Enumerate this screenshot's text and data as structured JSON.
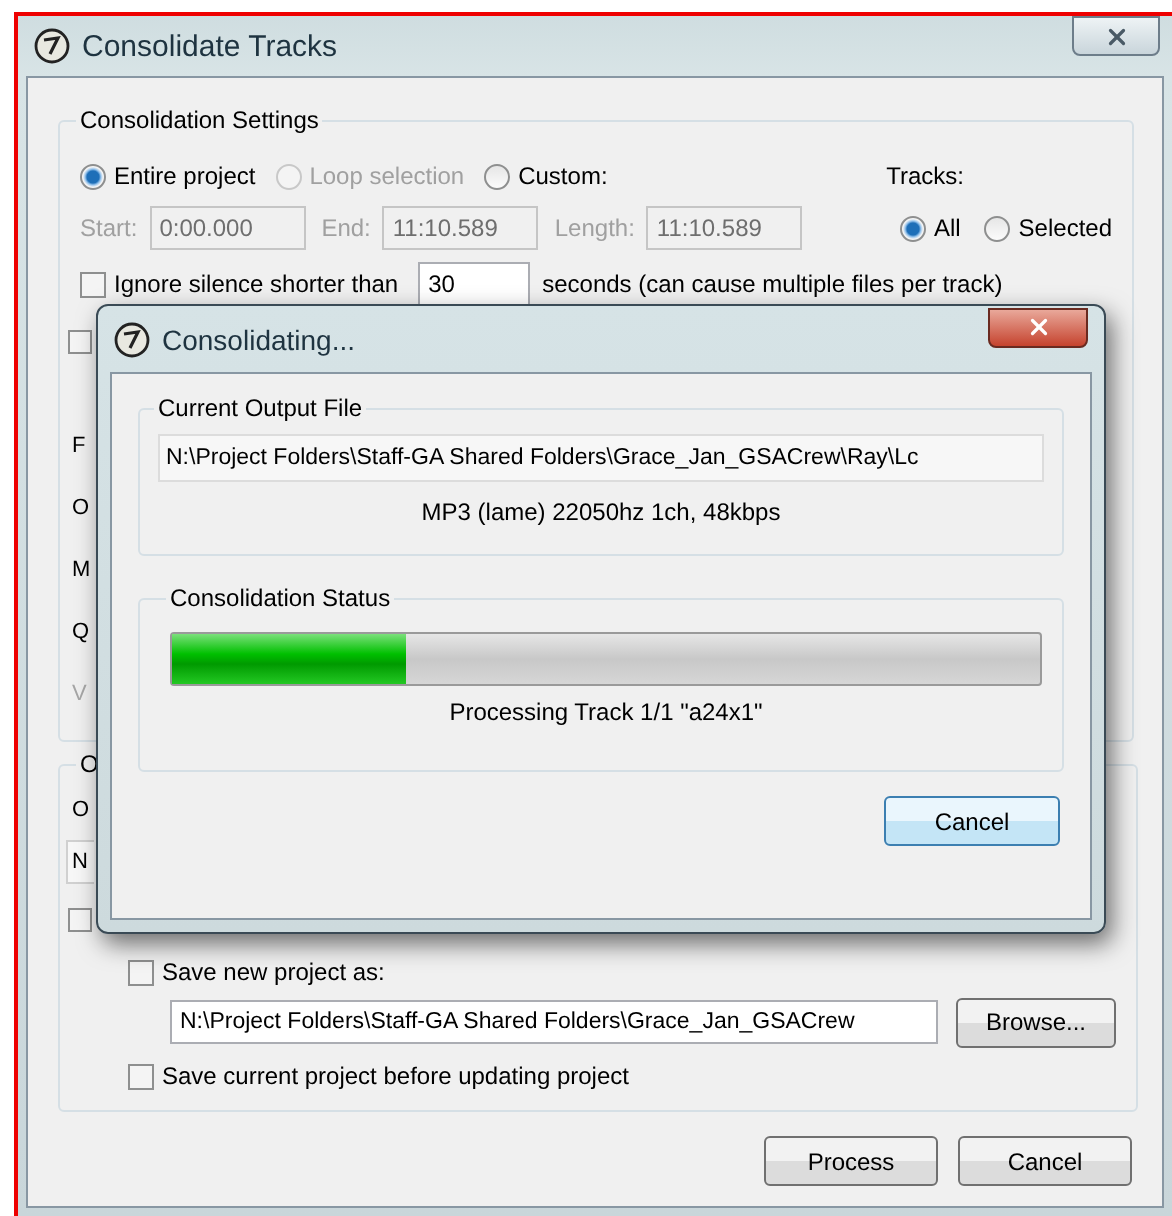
{
  "window": {
    "title": "Consolidate Tracks"
  },
  "settings": {
    "title": "Consolidation Settings",
    "range_options": [
      {
        "label": "Entire project",
        "selected": true,
        "disabled": false
      },
      {
        "label": "Loop selection",
        "selected": false,
        "disabled": true
      },
      {
        "label": "Custom:",
        "selected": false,
        "disabled": false
      }
    ],
    "tracks_label": "Tracks:",
    "times": [
      {
        "label": "Start:",
        "value": "0:00.000",
        "disabled": true
      },
      {
        "label": "End:",
        "value": "11:10.589",
        "disabled": true
      },
      {
        "label": "Length:",
        "value": "11:10.589",
        "disabled": true
      }
    ],
    "track_options": [
      {
        "label": "All",
        "selected": true
      },
      {
        "label": "Selected",
        "selected": false
      }
    ],
    "ignore_silence": {
      "checked": false,
      "label": "Ignore silence shorter than",
      "value": "30",
      "suffix": "seconds (can cause multiple files per track)"
    },
    "covered_option": {
      "checked": false
    },
    "covered_labels": [
      {
        "text": "F",
        "disabled": false
      },
      {
        "text": "O",
        "disabled": false
      },
      {
        "text": "M",
        "disabled": false
      },
      {
        "text": "Q",
        "disabled": false
      },
      {
        "text": "V",
        "disabled": true
      }
    ]
  },
  "output": {
    "title": "O",
    "label": "O",
    "field": "N",
    "covered_option": {
      "checked": false
    },
    "save_new": {
      "checked": false,
      "label": "Save new project as:",
      "path": "N:\\Project Folders\\Staff-GA Shared Folders\\Grace_Jan_GSACrew",
      "button": "Browse..."
    },
    "save_current": {
      "checked": false,
      "label": "Save current project before updating project"
    }
  },
  "buttons": [
    "Process",
    "Cancel"
  ],
  "progress_dialog": {
    "title": "Consolidating...",
    "output_title": "Current Output File",
    "output_path": "N:\\Project Folders\\Staff-GA Shared Folders\\Grace_Jan_GSACrew\\Ray\\Lc",
    "format": "MP3 (lame) 22050hz 1ch, 48kbps",
    "status_title": "Consolidation Status",
    "level": 0.27,
    "status": "Processing Track 1/1 \"a24x1\"",
    "cancel": "Cancel"
  }
}
